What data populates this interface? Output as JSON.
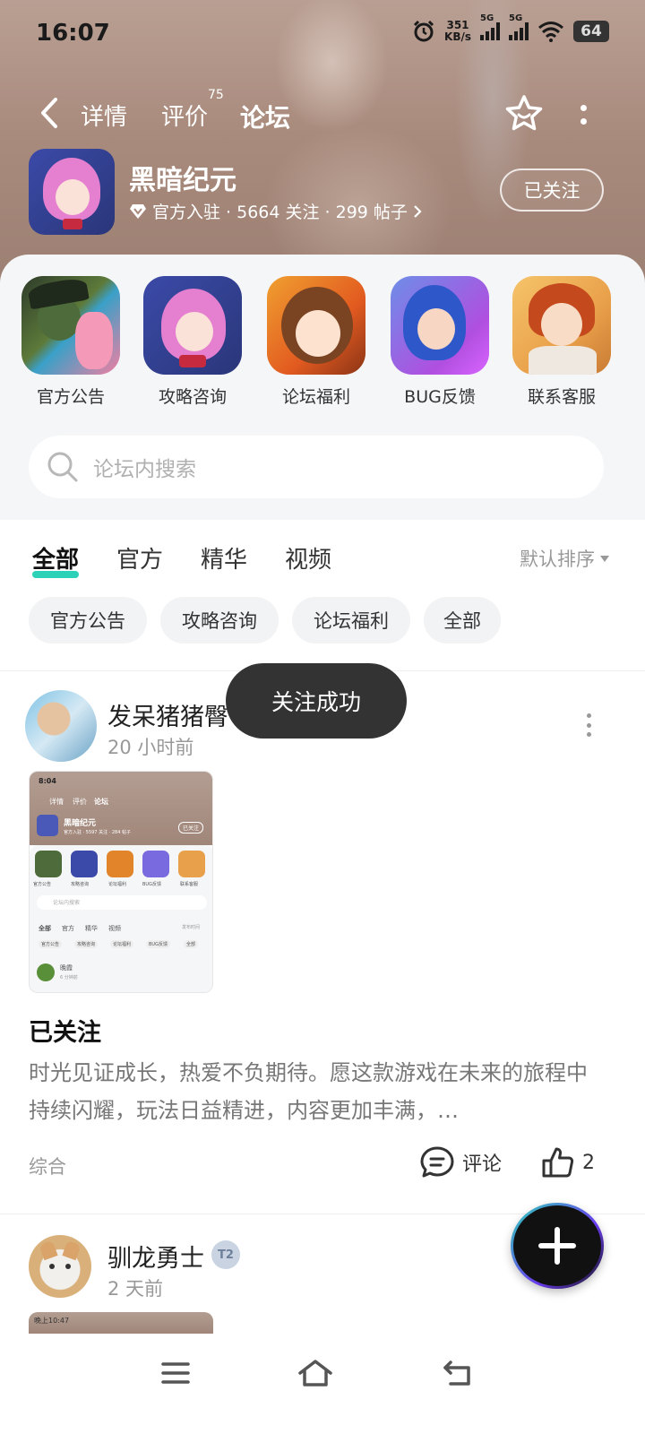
{
  "status_bar": {
    "time": "16:07",
    "net_speed_value": "351",
    "net_speed_unit": "KB/s",
    "signal_1_label": "5G",
    "signal_2_label": "5G",
    "battery": "64"
  },
  "top_nav": {
    "tabs": [
      {
        "label": "详情",
        "active": false
      },
      {
        "label": "评价",
        "active": false,
        "count": "75"
      },
      {
        "label": "论坛",
        "active": true
      }
    ]
  },
  "game": {
    "name": "黑暗纪元",
    "meta": "官方入驻 · 5664 关注 · 299 帖子",
    "follow_label": "已关注"
  },
  "quick_links": [
    {
      "label": "官方公告",
      "icon": "witch-character-icon"
    },
    {
      "label": "攻略咨询",
      "icon": "maid-character-icon"
    },
    {
      "label": "论坛福利",
      "icon": "wink-character-icon"
    },
    {
      "label": "BUG反馈",
      "icon": "blue-hair-character-icon"
    },
    {
      "label": "联系客服",
      "icon": "red-hair-character-icon"
    }
  ],
  "search": {
    "placeholder": "论坛内搜索"
  },
  "filter_tabs": [
    {
      "label": "全部",
      "active": true
    },
    {
      "label": "官方",
      "active": false
    },
    {
      "label": "精华",
      "active": false
    },
    {
      "label": "视频",
      "active": false
    }
  ],
  "sort_label": "默认排序",
  "chips": [
    "官方公告",
    "攻略咨询",
    "论坛福利",
    "全部"
  ],
  "posts": [
    {
      "username": "发呆猪猪臀",
      "time": "20 小时前",
      "title": "已关注",
      "body": "时光见证成长，热爱不负期待。愿这款游戏在未来的旅程中持续闪耀，玩法日益精进，内容更加丰满，…",
      "category": "综合",
      "comment_label": "评论",
      "like_count": "2",
      "thumbnail": {
        "time": "8:04",
        "tabs": [
          "详情",
          "评价",
          "论坛"
        ],
        "game_name": "黑暗纪元",
        "game_meta": "官方入驻 · 5597 关注 · 284 帖子",
        "follow_label": "已关注",
        "links": [
          "官方公告",
          "攻略咨询",
          "论坛福利",
          "BUG反馈",
          "联系客服"
        ],
        "search": "论坛内搜索",
        "filter_tabs": [
          "全部",
          "官方",
          "精华",
          "视频"
        ],
        "sort": "发布时间",
        "chips": [
          "官方公告",
          "攻略咨询",
          "论坛福利",
          "BUG反馈",
          "全部"
        ],
        "user": "晚霞",
        "user_time": "6 分钟前"
      }
    },
    {
      "username": "驯龙勇士",
      "badge": "T2",
      "time": "2 天前",
      "thumbnail_time": "晚上10:47"
    }
  ],
  "toast": "关注成功",
  "colors": {
    "accent": "#2cd1b8",
    "header_bg": "#a98b7d",
    "card_bg": "#f5f6f8"
  }
}
